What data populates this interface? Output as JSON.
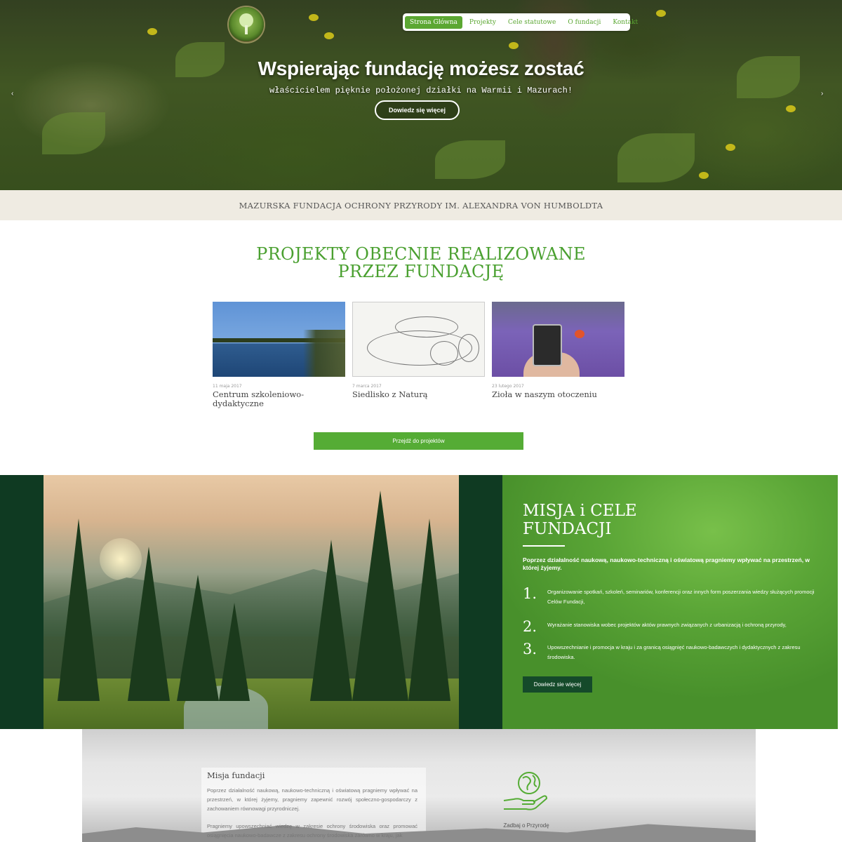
{
  "nav": {
    "items": [
      "Strona Główna",
      "Projekty",
      "Cele statutowe",
      "O fundacji",
      "Kontakt"
    ],
    "active_index": 0
  },
  "hero": {
    "title": "Wspierając fundację możesz zostać",
    "subtitle": "właścicielem pięknie położonej działki na Warmii i Mazurach!",
    "button": "Dowiedz się więcej",
    "prev_arrow": "‹",
    "next_arrow": "›"
  },
  "tagline": "MAZURSKA FUNDACJA OCHRONY PRZYRODY IM. ALEXANDRA VON HUMBOLDTA",
  "projects": {
    "title_line1": "PROJEKTY OBECNIE REALIZOWANE",
    "title_line2": "PRZEZ FUNDACJĘ",
    "items": [
      {
        "date": "11 maja 2017",
        "title": "Centrum szkoleniowo-dydaktyczne"
      },
      {
        "date": "7 marca 2017",
        "title": "Siedlisko z Naturą"
      },
      {
        "date": "23 lutego 2017",
        "title": "Zioła w naszym otoczeniu"
      }
    ],
    "button": "Przejdź do projektów"
  },
  "mission": {
    "title_line1": "MISJA i CELE",
    "title_line2": "FUNDACJI",
    "lead": "Poprzez działalność naukową, naukowo-techniczną i oświatową pragniemy wpływać na przestrzeń, w której żyjemy.",
    "items": [
      {
        "num": "1.",
        "text": "Organizowanie spotkań, szkoleń, seminariów, konferencji oraz innych form poszerzania wiedzy służących promocji Celów Fundacji,"
      },
      {
        "num": "2.",
        "text": "Wyrażanie stanowiska wobec projektów aktów prawnych związanych z urbanizacją i ochroną przyrody,"
      },
      {
        "num": "3.",
        "text": "Upowszechnianie i promocja w kraju i za granicą osiągnięć naukowo-badawczych i dydaktycznych z zakresu środowiska."
      }
    ],
    "button": "Dowiedz sie więcej"
  },
  "bottom": {
    "title": "Misja fundacji",
    "para1": "Poprzez działalność naukową, naukowo-techniczną i oświatową pragniemy wpływać na przestrzeń, w której żyjemy, pragniemy zapewnić rozwój społeczno-gospodarczy z zachowaniem równowagi przyrodniczej.",
    "para2": "Pragniemy upowszechniać wiedzę w zakresie ochrony środowiska oraz promować osiągnięcia naukowo-badawcze z zakresu ochrony środowiska zarówno w kraju, jak",
    "icon": "globe-hand-icon",
    "caption": "Zadbaj o Przyrodę"
  },
  "colors": {
    "brand_green": "#55ac35",
    "dark_green": "#0f3a22",
    "band_beige": "#efebe2"
  }
}
